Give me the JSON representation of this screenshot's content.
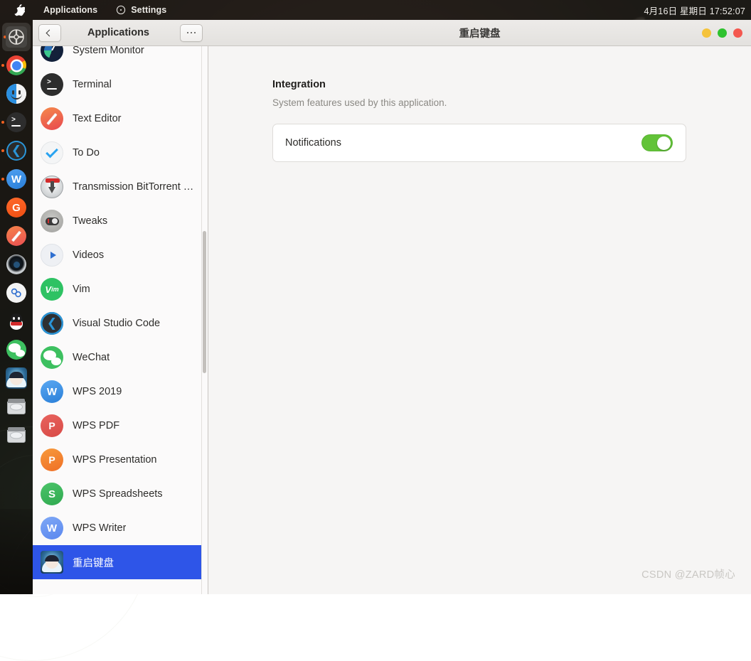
{
  "topbar": {
    "apple_icon": "apple-logo-icon",
    "menus": [
      {
        "label": "Applications",
        "icon": ""
      },
      {
        "label": "Settings",
        "icon": "settings-compass-icon"
      }
    ],
    "clock": "4月16日 星期日  17:52:07"
  },
  "dock": {
    "items": [
      {
        "name": "settings",
        "icon": "gear-icon",
        "active": true,
        "running": true
      },
      {
        "name": "chrome",
        "icon": "chrome-icon",
        "active": false,
        "running": true
      },
      {
        "name": "files",
        "icon": "finder-face-icon",
        "active": false,
        "running": false
      },
      {
        "name": "terminal",
        "icon": "terminal-icon",
        "active": false,
        "running": true
      },
      {
        "name": "visual-studio-code",
        "icon": "vscode-icon",
        "active": false,
        "running": true
      },
      {
        "name": "wps-2019",
        "icon": "wps-writer-icon",
        "active": false,
        "running": true
      },
      {
        "name": "gitkraken",
        "icon": "g-orange-icon",
        "active": false,
        "running": false
      },
      {
        "name": "text-editor",
        "icon": "pencil-icon",
        "active": false,
        "running": false
      },
      {
        "name": "camera",
        "icon": "lens-icon",
        "active": false,
        "running": false
      },
      {
        "name": "bluetooth-share",
        "icon": "link-icon",
        "active": false,
        "running": false
      },
      {
        "name": "qq",
        "icon": "qq-penguin-icon",
        "active": false,
        "running": false
      },
      {
        "name": "wechat",
        "icon": "wechat-icon",
        "active": false,
        "running": false
      },
      {
        "name": "chongqi-jianpan",
        "icon": "anime-face-icon",
        "active": false,
        "running": false
      },
      {
        "name": "disk-1",
        "icon": "hard-drive-icon",
        "active": false,
        "running": false
      },
      {
        "name": "disk-2",
        "icon": "hard-drive-icon",
        "active": false,
        "running": false
      }
    ]
  },
  "window": {
    "sidebar_title": "Applications",
    "main_title": "重启键盘",
    "back_label": "Back",
    "menu_label": "Main Menu",
    "traffic": {
      "minimize": "#f5c33b",
      "maximize": "#2fc22f",
      "close": "#f4584f"
    }
  },
  "sidebar": {
    "items": [
      {
        "label": "System Monitor",
        "icon": "system-monitor-icon",
        "selected": false
      },
      {
        "label": "Terminal",
        "icon": "terminal-icon",
        "selected": false
      },
      {
        "label": "Text Editor",
        "icon": "text-editor-icon",
        "selected": false
      },
      {
        "label": "To Do",
        "icon": "todo-check-icon",
        "selected": false
      },
      {
        "label": "Transmission BitTorrent …",
        "icon": "transmission-icon",
        "selected": false
      },
      {
        "label": "Tweaks",
        "icon": "tweaks-icon",
        "selected": false
      },
      {
        "label": "Videos",
        "icon": "videos-play-icon",
        "selected": false
      },
      {
        "label": "Vim",
        "icon": "vim-icon",
        "selected": false
      },
      {
        "label": "Visual Studio Code",
        "icon": "vscode-icon",
        "selected": false
      },
      {
        "label": "WeChat",
        "icon": "wechat-icon",
        "selected": false
      },
      {
        "label": "WPS 2019",
        "icon": "wps-2019-icon",
        "selected": false
      },
      {
        "label": "WPS PDF",
        "icon": "wps-pdf-icon",
        "selected": false
      },
      {
        "label": "WPS Presentation",
        "icon": "wps-presentation-icon",
        "selected": false
      },
      {
        "label": "WPS Spreadsheets",
        "icon": "wps-spreadsheets-icon",
        "selected": false
      },
      {
        "label": "WPS Writer",
        "icon": "wps-writer-icon",
        "selected": false
      },
      {
        "label": "重启键盘",
        "icon": "anime-face-icon",
        "selected": true
      }
    ]
  },
  "main": {
    "section_title": "Integration",
    "section_subtitle": "System features used by this application.",
    "rows": [
      {
        "label": "Notifications",
        "control": "toggle",
        "value": "on",
        "color": "#62c338"
      }
    ]
  },
  "watermark": "CSDN @ZARD帧心"
}
